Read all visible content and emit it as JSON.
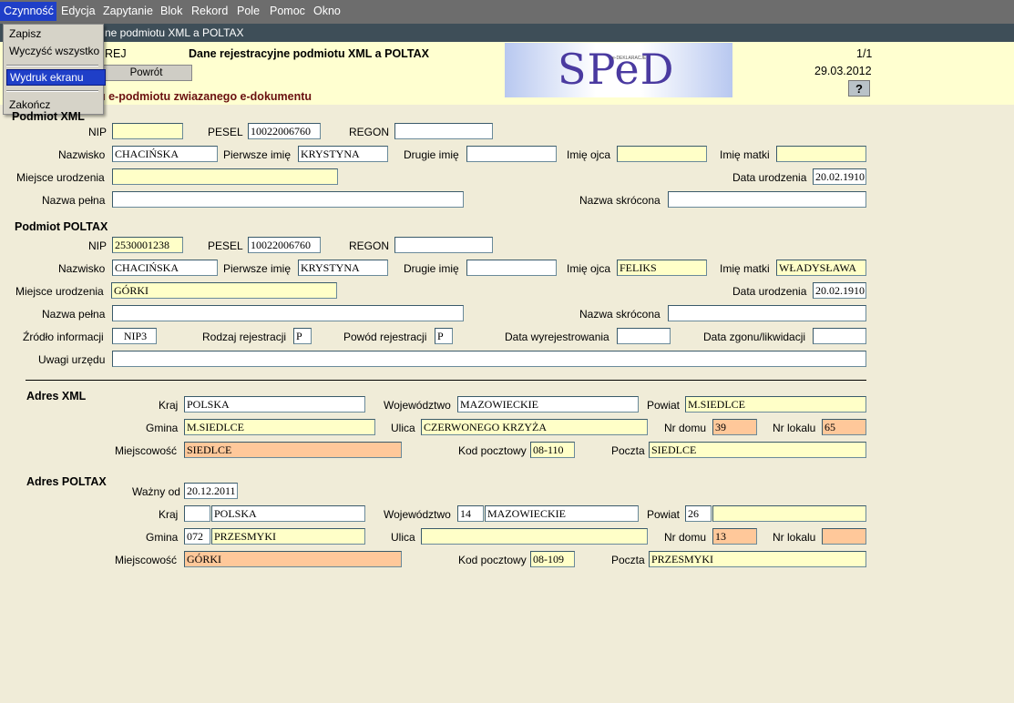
{
  "menubar": {
    "items": [
      "Czynność",
      "Edycja",
      "Zapytanie",
      "Blok",
      "Rekord",
      "Pole",
      "Pomoc",
      "Okno"
    ]
  },
  "window_title": "ne podmiotu XML a POLTAX",
  "dropdown": {
    "items": [
      "Zapisz",
      "Wyczyść wszystko",
      "Wydruk ekranu",
      "Zakończ"
    ]
  },
  "header": {
    "code": "REJ",
    "title": "Dane rejestracyjne podmiotu XML a POLTAX",
    "subtitle": "u e-podmiotu zwiazanego e-dokumentu",
    "back_button": "Powrót",
    "page": "1/1",
    "date": "29.03.2012",
    "help_button": "?",
    "logo_text": "SPeD",
    "logo_small": "e-DEKLARACJE"
  },
  "labels": {
    "nip": "NIP",
    "pesel": "PESEL",
    "regon": "REGON",
    "nazwisko": "Nazwisko",
    "pierwsze_imie": "Pierwsze imię",
    "drugie_imie": "Drugie imię",
    "imie_ojca": "Imię ojca",
    "imie_matki": "Imię matki",
    "miejsce_urodzenia": "Miejsce urodzenia",
    "data_urodzenia": "Data urodzenia",
    "nazwa_pelna": "Nazwa pełna",
    "nazwa_skrocona": "Nazwa skrócona",
    "zrodlo_informacji": "Źródło informacji",
    "rodzaj_rejestracji": "Rodzaj rejestracji",
    "powod_rejestracji": "Powód rejestracji",
    "data_wyrejestrowania": "Data wyrejestrowania",
    "data_zgonu": "Data zgonu/likwidacji",
    "uwagi_urzedu": "Uwagi urzędu",
    "kraj": "Kraj",
    "wojewodztwo": "Województwo",
    "powiat": "Powiat",
    "gmina": "Gmina",
    "ulica": "Ulica",
    "nr_domu": "Nr domu",
    "nr_lokalu": "Nr lokalu",
    "miejscowosc": "Miejscowość",
    "kod_pocztowy": "Kod pocztowy",
    "poczta": "Poczta",
    "wazny_od": "Ważny od"
  },
  "sections": {
    "podmiot_xml": "Podmiot XML",
    "podmiot_poltax": "Podmiot POLTAX",
    "adres_xml": "Adres XML",
    "adres_poltax": "Adres POLTAX"
  },
  "podmiot_xml": {
    "nip": "",
    "pesel": "10022006760",
    "regon": "",
    "nazwisko": "CHACIŃSKA",
    "pierwsze_imie": "KRYSTYNA",
    "drugie_imie": "",
    "imie_ojca": "",
    "imie_matki": "",
    "miejsce_urodzenia": "",
    "data_urodzenia": "20.02.1910",
    "nazwa_pelna": "",
    "nazwa_skrocona": ""
  },
  "podmiot_poltax": {
    "nip": "2530001238",
    "pesel": "10022006760",
    "regon": "",
    "nazwisko": "CHACIŃSKA",
    "pierwsze_imie": "KRYSTYNA",
    "drugie_imie": "",
    "imie_ojca": "FELIKS",
    "imie_matki": "WŁADYSŁAWA",
    "miejsce_urodzenia": "GÓRKI",
    "data_urodzenia": "20.02.1910",
    "nazwa_pelna": "",
    "nazwa_skrocona": "",
    "zrodlo_informacji": "NIP3",
    "rodzaj_rejestracji": "P",
    "powod_rejestracji": "P",
    "data_wyrejestrowania": "",
    "data_zgonu": "",
    "uwagi_urzedu": ""
  },
  "adres_xml": {
    "kraj": "POLSKA",
    "wojewodztwo": "MAZOWIECKIE",
    "powiat": "M.SIEDLCE",
    "gmina": "M.SIEDLCE",
    "ulica": "CZERWONEGO KRZYŻA",
    "nr_domu": "39",
    "nr_lokalu": "65",
    "miejscowosc": "SIEDLCE",
    "kod_pocztowy": "08-110",
    "poczta": "SIEDLCE"
  },
  "adres_poltax": {
    "wazny_od": "20.12.2011",
    "kraj_kod": "",
    "kraj": "POLSKA",
    "woj_kod": "14",
    "wojewodztwo": "MAZOWIECKIE",
    "powiat_kod": "26",
    "powiat": "",
    "gmina_kod": "072",
    "gmina": "PRZESMYKI",
    "ulica": "",
    "nr_domu": "13",
    "nr_lokalu": "",
    "miejscowosc": "GÓRKI",
    "kod_pocztowy": "08-109",
    "poczta": "PRZESMYKI"
  },
  "colors": {
    "menubar": "#6d6d6d",
    "menu_active": "#1f3fc8",
    "field_yellow": "#ffffc8",
    "field_orange": "#ffc89a",
    "background": "#f0ecd8",
    "header": "#ffffd0"
  }
}
